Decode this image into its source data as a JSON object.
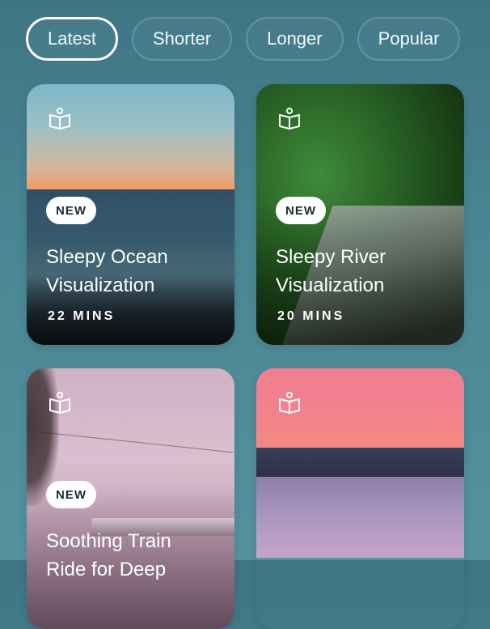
{
  "filters": [
    {
      "label": "Latest",
      "active": true
    },
    {
      "label": "Shorter",
      "active": false
    },
    {
      "label": "Longer",
      "active": false
    },
    {
      "label": "Popular",
      "active": false
    }
  ],
  "cards": [
    {
      "badge": "NEW",
      "title_line1": "Sleepy Ocean",
      "title_line2": "Visualization",
      "duration": "22 MINS",
      "icon": "book-open-icon"
    },
    {
      "badge": "NEW",
      "title_line1": "Sleepy River",
      "title_line2": "Visualization",
      "duration": "20 MINS",
      "icon": "book-open-icon"
    },
    {
      "badge": "NEW",
      "title_line1": "Soothing Train",
      "title_line2": "Ride for Deep",
      "duration": "",
      "icon": "book-open-icon"
    },
    {
      "badge": "",
      "title_line1": "",
      "title_line2": "",
      "duration": "",
      "icon": "book-open-icon"
    }
  ],
  "colors": {
    "background": "#4a8795",
    "badge_bg": "#ffffff",
    "badge_text": "#1d2b33"
  }
}
